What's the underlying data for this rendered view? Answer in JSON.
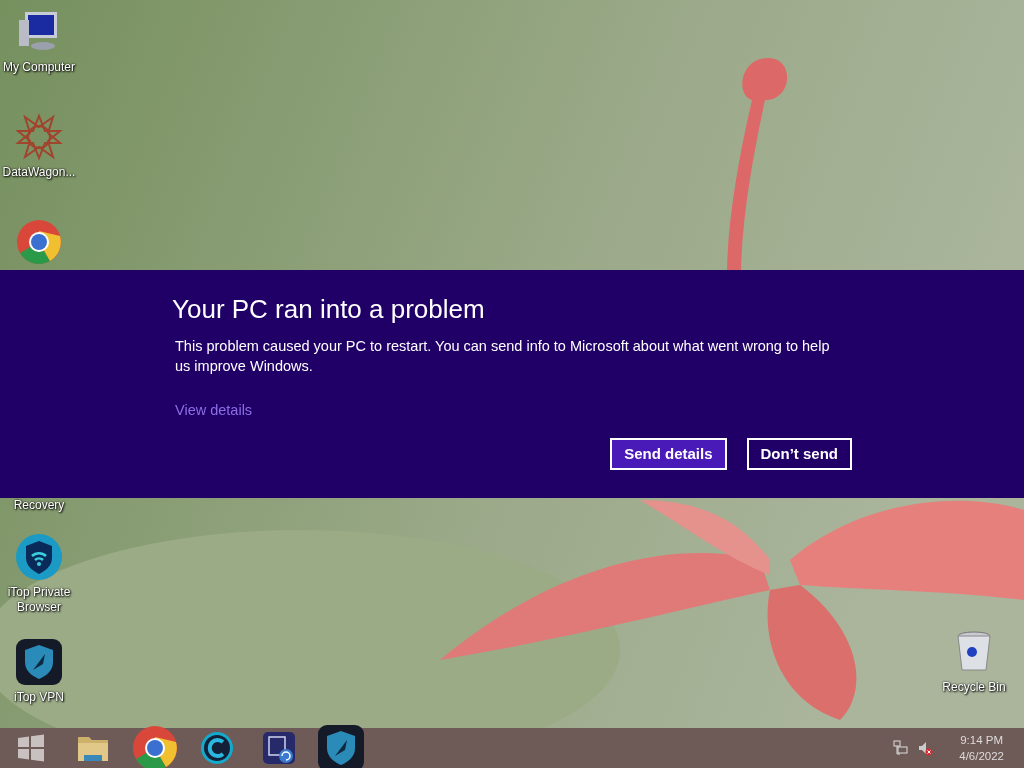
{
  "desktop_icons": [
    {
      "kind": "computer",
      "label": "My Computer"
    },
    {
      "kind": "star",
      "label": "DataWagon..."
    },
    {
      "kind": "chrome"
    },
    {
      "kind": "hidden",
      "label": "Recovery"
    },
    {
      "kind": "shield-wifi",
      "label": "iTop Private Browser"
    },
    {
      "kind": "shield-vpn",
      "label": "iTop VPN"
    },
    {
      "kind": "recycle-bin",
      "label": "Recycle Bin"
    }
  ],
  "dialog": {
    "title": "Your PC ran into a problem",
    "message": "This problem caused your PC to restart. You can send info to Microsoft about what went wrong to help us improve Windows.",
    "link": "View details",
    "buttons": [
      {
        "label": "Send details",
        "primary": true
      },
      {
        "label": "Don’t send",
        "primary": false
      }
    ]
  },
  "taskbar": {
    "apps": [
      {
        "kind": "windows"
      },
      {
        "kind": "folder"
      },
      {
        "kind": "chrome"
      },
      {
        "kind": "c-logo"
      },
      {
        "kind": "image-app"
      },
      {
        "kind": "shield-vpn"
      }
    ],
    "tray": {
      "time": "9:14 PM",
      "date": "4/6/2022"
    }
  }
}
